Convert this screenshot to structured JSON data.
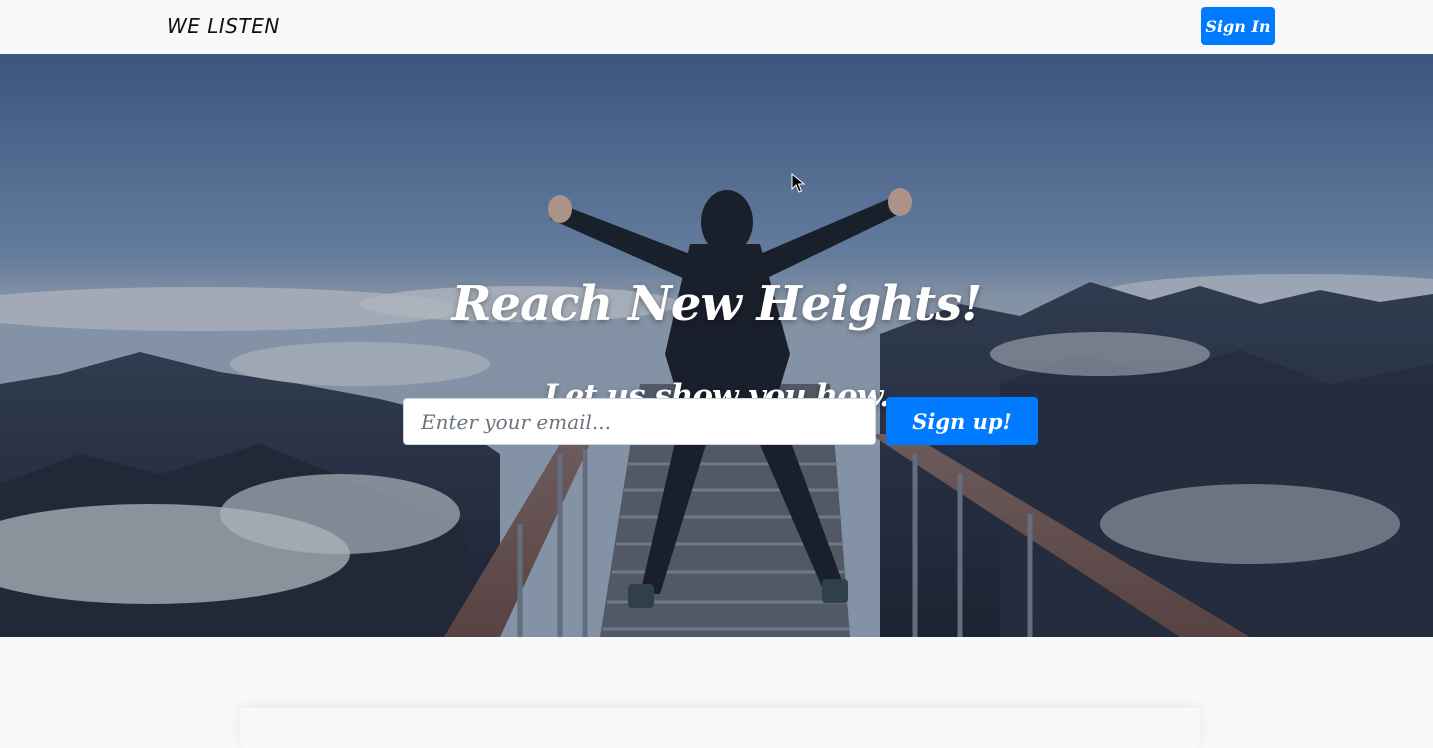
{
  "navbar": {
    "brand": "WE LISTEN",
    "signin_label": "Sign In"
  },
  "hero": {
    "title": "Reach New Heights!",
    "subtitle": "Let us show you how.",
    "email_placeholder": "Enter your email...",
    "email_value": "",
    "signup_label": "Sign up!"
  },
  "colors": {
    "primary": "#007bff",
    "page_background": "#f8f9fa",
    "hero_text": "#ffffff"
  }
}
